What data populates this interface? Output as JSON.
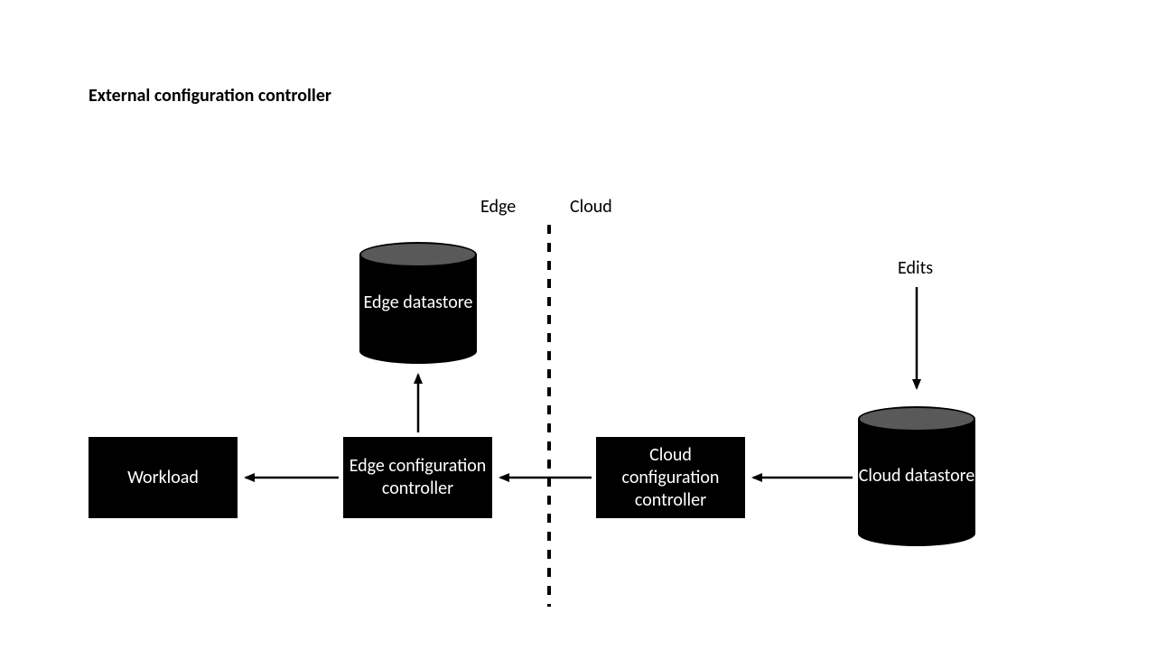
{
  "title": "External configuration controller",
  "labels": {
    "edge": "Edge",
    "cloud": "Cloud",
    "edits": "Edits"
  },
  "nodes": {
    "workload": "Workload",
    "edge_datastore": "Edge datastore",
    "edge_controller": "Edge configuration controller",
    "cloud_controller": "Cloud configuration controller",
    "cloud_datastore": "Cloud datastore"
  }
}
